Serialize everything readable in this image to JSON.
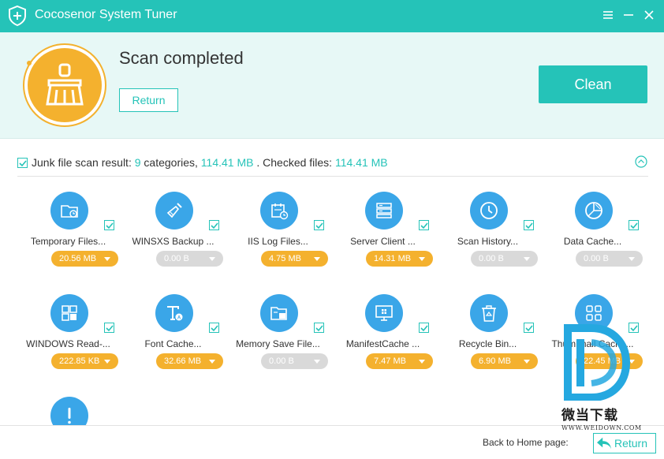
{
  "app": {
    "title": "Cocosenor System Tuner"
  },
  "header": {
    "scan_title": "Scan completed",
    "return_label": "Return",
    "clean_label": "Clean"
  },
  "result": {
    "prefix": "Junk file scan result:",
    "categories_count": "9",
    "categories_word": "categories,",
    "total_size": "114.41 MB",
    "checked_label": ". Checked files:",
    "checked_size": "114.41 MB"
  },
  "items": [
    {
      "label": "Temporary Files...",
      "size": "20.56 MB",
      "icon": "folder-clock-icon",
      "checked": true,
      "zero": false
    },
    {
      "label": "WINSXS Backup ...",
      "size": "0.00 B",
      "icon": "broom-icon",
      "checked": true,
      "zero": true
    },
    {
      "label": "IIS Log Files...",
      "size": "4.75 MB",
      "icon": "calendar-clock-icon",
      "checked": true,
      "zero": false
    },
    {
      "label": "Server Client ...",
      "size": "14.31 MB",
      "icon": "server-icon",
      "checked": true,
      "zero": false
    },
    {
      "label": "Scan History...",
      "size": "0.00 B",
      "icon": "clock-icon",
      "checked": true,
      "zero": true
    },
    {
      "label": "Data Cache...",
      "size": "0.00 B",
      "icon": "pie-chart-icon",
      "checked": true,
      "zero": true
    },
    {
      "label": "WINDOWS Read-...",
      "size": "222.85 KB",
      "icon": "windows-icon",
      "checked": true,
      "zero": false
    },
    {
      "label": "Font Cache...",
      "size": "32.66 MB",
      "icon": "font-icon",
      "checked": true,
      "zero": false
    },
    {
      "label": "Memory Save File...",
      "size": "0.00 B",
      "icon": "memory-folder-icon",
      "checked": true,
      "zero": true
    },
    {
      "label": "ManifestCache ...",
      "size": "7.47 MB",
      "icon": "monitor-icon",
      "checked": true,
      "zero": false
    },
    {
      "label": "Recycle Bin...",
      "size": "6.90 MB",
      "icon": "recycle-bin-icon",
      "checked": true,
      "zero": false
    },
    {
      "label": "Thumbnail Cache...",
      "size": "22.45 MB",
      "icon": "thumbnail-grid-icon",
      "checked": true,
      "zero": false
    },
    {
      "label": "",
      "size": "",
      "icon": "exclamation-icon",
      "checked": false,
      "zero": false
    }
  ],
  "footer": {
    "back_label": "Back to Home page:",
    "return_label": "Return"
  },
  "watermark": {
    "cn_text": "微当下载",
    "en_text": "WWW.WEIDOWN.COM"
  },
  "colors": {
    "accent": "#25c3b8",
    "orange": "#f4b12e",
    "icon_blue": "#3aa6e8",
    "zero_gray": "#d9d9d9"
  }
}
